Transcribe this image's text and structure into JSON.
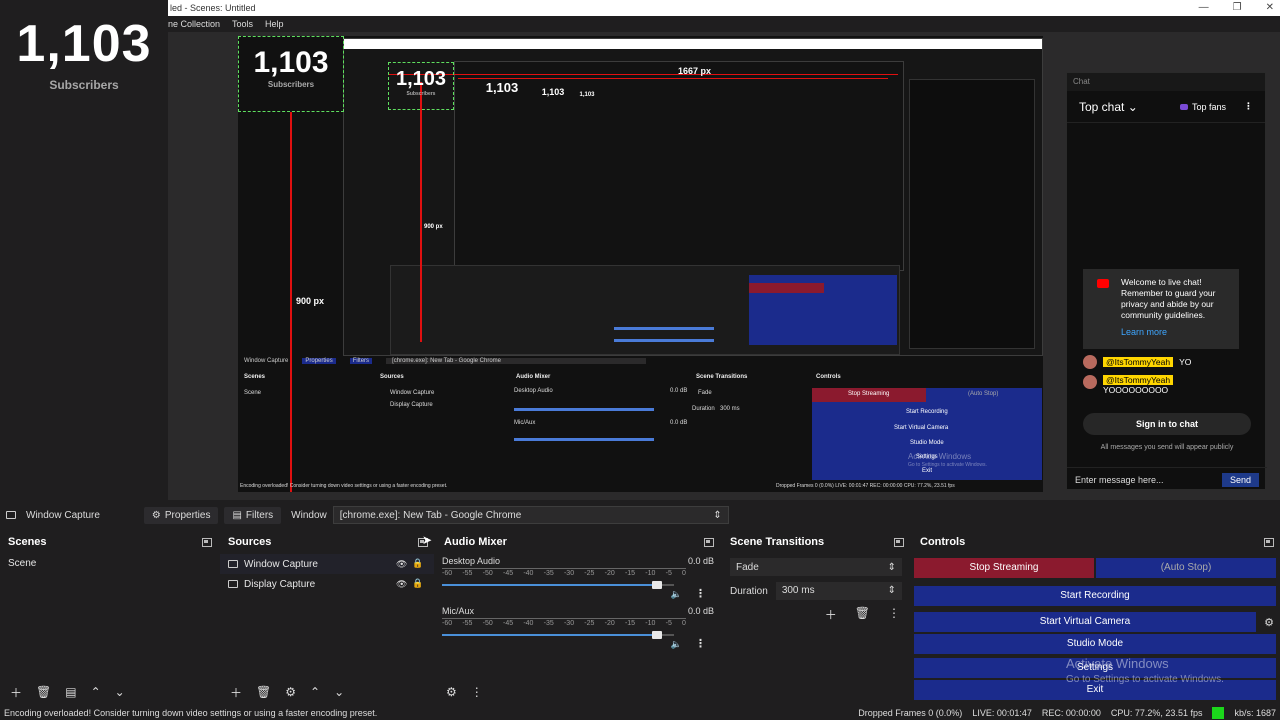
{
  "app": {
    "window_title": "led - Scenes: Untitled",
    "menu": [
      "ne Collection",
      "Tools",
      "Help"
    ],
    "window_controls": [
      "—",
      "❐",
      "✕"
    ]
  },
  "overlay": {
    "subscribers_count": "1,103",
    "subscribers_label": "Subscribers"
  },
  "preview": {
    "guide_width": "1667 px",
    "guide_height": "900 px",
    "guide_height_inner": "900 px",
    "mini_counts": [
      "1,103",
      "1,103",
      "1,103",
      "1,103",
      "1,103"
    ],
    "mini_label": "Subscribers",
    "inner_status": "Encoding overloaded! Consider turning down video settings or using a faster encoding preset.",
    "inner_status_right": "Dropped Frames 0 (0.0%)   LIVE: 00:01:47   REC: 00:00:00   CPU: 77.2%, 23.51 fps",
    "inner_window_label": "Window Capture",
    "inner_tab_properties": "Properties",
    "inner_tab_filters": "Filters",
    "inner_window_field": "[chrome.exe]: New Tab - Google Chrome",
    "inner_docks": [
      "Scenes",
      "Sources",
      "Audio Mixer",
      "Scene Transitions",
      "Controls"
    ],
    "inner_scene": "Scene",
    "inner_sources": [
      "Window Capture",
      "Display Capture"
    ],
    "inner_mixer": [
      "Desktop Audio",
      "Mic/Aux"
    ],
    "inner_db": "0.0 dB",
    "inner_fade": "Fade",
    "inner_duration_label": "Duration",
    "inner_duration": "300 ms",
    "inner_controls": [
      "Stop Streaming",
      "(Auto Stop)",
      "Start Recording",
      "Start Virtual Camera",
      "Studio Mode",
      "Settings",
      "Exit"
    ],
    "inner_activate": "Activate Windows",
    "inner_activate_sub": "Go to Settings to activate Windows."
  },
  "chat": {
    "title": "Chat",
    "top_chat": "Top chat ⌄",
    "top_fans": "Top fans",
    "welcome": "Welcome to live chat! Remember to guard your privacy and abide by our community guidelines.",
    "learn_more": "Learn more",
    "messages": [
      {
        "name": "@ItsTommyYeah",
        "text": "YO"
      },
      {
        "name": "@ItsTommyYeah",
        "text": "YOOOOOOOOO"
      }
    ],
    "sign_in": "Sign in to chat",
    "public_note": "All messages you send will appear publicly",
    "input_placeholder": "Enter message here...",
    "send": "Send"
  },
  "source_toolbar": {
    "source_name": "Window Capture",
    "properties": "Properties",
    "filters": "Filters",
    "window_label": "Window",
    "window_value": "[chrome.exe]: New Tab - Google Chrome"
  },
  "docks": {
    "scenes": {
      "title": "Scenes",
      "items": [
        "Scene"
      ]
    },
    "sources": {
      "title": "Sources",
      "items": [
        "Window Capture",
        "Display Capture"
      ]
    },
    "mixer": {
      "title": "Audio Mixer",
      "tracks": [
        {
          "name": "Desktop Audio",
          "db": "0.0 dB",
          "level": 0.95
        },
        {
          "name": "Mic/Aux",
          "db": "0.0 dB",
          "level": 0.95
        }
      ],
      "scale": [
        "-60",
        "-55",
        "-50",
        "-45",
        "-40",
        "-35",
        "-30",
        "-25",
        "-20",
        "-15",
        "-10",
        "-5",
        "0"
      ]
    },
    "transitions": {
      "title": "Scene Transitions",
      "selected": "Fade",
      "duration_label": "Duration",
      "duration": "300 ms"
    },
    "controls": {
      "title": "Controls",
      "stop_streaming": "Stop Streaming",
      "auto_stop": "(Auto Stop)",
      "start_recording": "Start Recording",
      "start_virtual_camera": "Start Virtual Camera",
      "studio_mode": "Studio Mode",
      "settings": "Settings",
      "exit": "Exit",
      "activate_windows": "Activate Windows",
      "activate_sub": "Go to Settings to activate Windows."
    }
  },
  "status": {
    "message": "Encoding overloaded! Consider turning down video settings or using a faster encoding preset.",
    "dropped": "Dropped Frames 0 (0.0%)",
    "live": "LIVE: 00:01:47",
    "rec": "REC: 00:00:00",
    "cpu": "CPU: 77.2%, 23.51 fps",
    "kbps": "kb/s: 1687"
  },
  "colors": {
    "accent_blue": "#1b2b8c",
    "stop_red": "#8b1a2e",
    "guide_red": "#e01010",
    "selection_green": "#5fe05f",
    "status_green": "#1bd61b"
  }
}
